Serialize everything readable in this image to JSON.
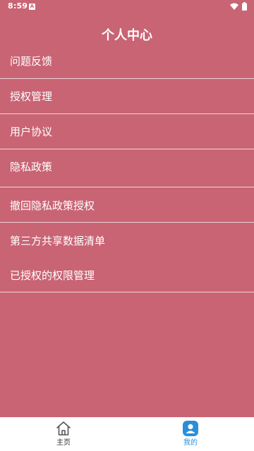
{
  "status_bar": {
    "time": "8:59",
    "notification_icon": "android-notification-icon",
    "wifi_icon": "wifi-icon",
    "battery_icon": "battery-icon"
  },
  "header": {
    "title": "个人中心"
  },
  "menu": {
    "items": [
      {
        "label": "问题反馈"
      },
      {
        "label": "授权管理"
      },
      {
        "label": "用户协议"
      },
      {
        "label": "隐私政策"
      },
      {
        "label": "撤回隐私政策授权"
      },
      {
        "label": "第三方共享数据清单"
      },
      {
        "label": "已授权的权限管理"
      }
    ]
  },
  "bottom_nav": {
    "items": [
      {
        "label": "主页",
        "icon": "home-icon",
        "active": false
      },
      {
        "label": "我的",
        "icon": "user-icon",
        "active": true
      }
    ]
  },
  "colors": {
    "background": "#c96474",
    "nav_background": "#ffffff",
    "active": "#2b8fd8",
    "inactive": "#333333",
    "divider": "#efd6da"
  }
}
